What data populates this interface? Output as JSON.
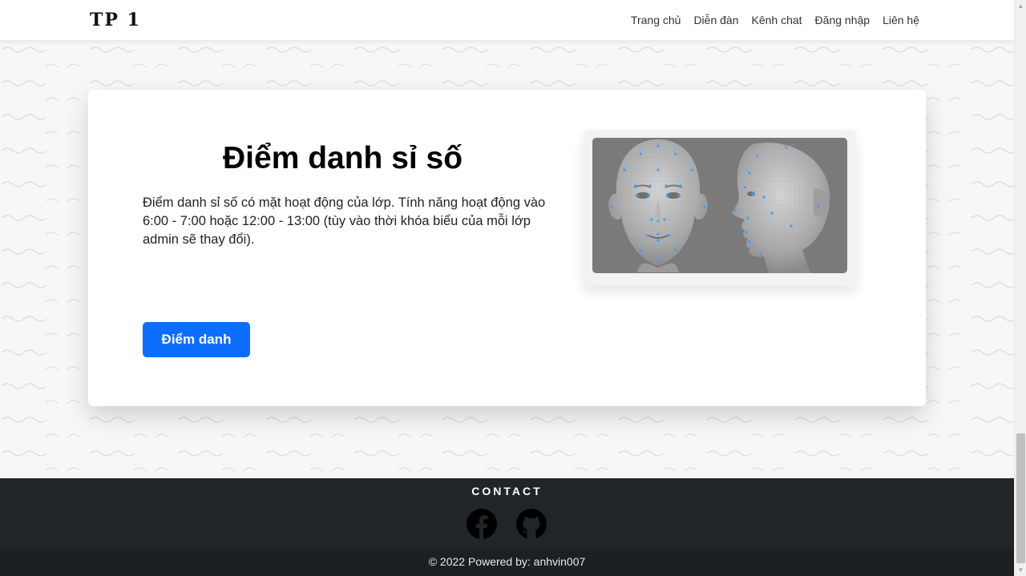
{
  "navbar": {
    "brand": "TP 1",
    "links": [
      "Trang chủ",
      "Diễn đàn",
      "Kênh chat",
      "Đăng nhập",
      "Liên hệ"
    ]
  },
  "card": {
    "title": "Điểm danh sỉ số",
    "description": "Điểm danh sỉ số có mặt hoạt động của lớp. Tính năng hoạt động vào 6:00 - 7:00 hoặc 12:00 - 13:00 (tùy vào thời khóa biểu của mỗi lớp admin sẽ thay đổi).",
    "button_label": "Điểm danh",
    "image_icon": "face-landmarks-illustration"
  },
  "footer": {
    "contact_title": "CONTACT",
    "social_icons": [
      "facebook-icon",
      "github-icon"
    ],
    "copyright": "© 2022 Powered by: anhvin007"
  },
  "colors": {
    "accent": "#0d6efd",
    "footer_bg": "#212529",
    "page_bg": "#f7f7f7"
  }
}
